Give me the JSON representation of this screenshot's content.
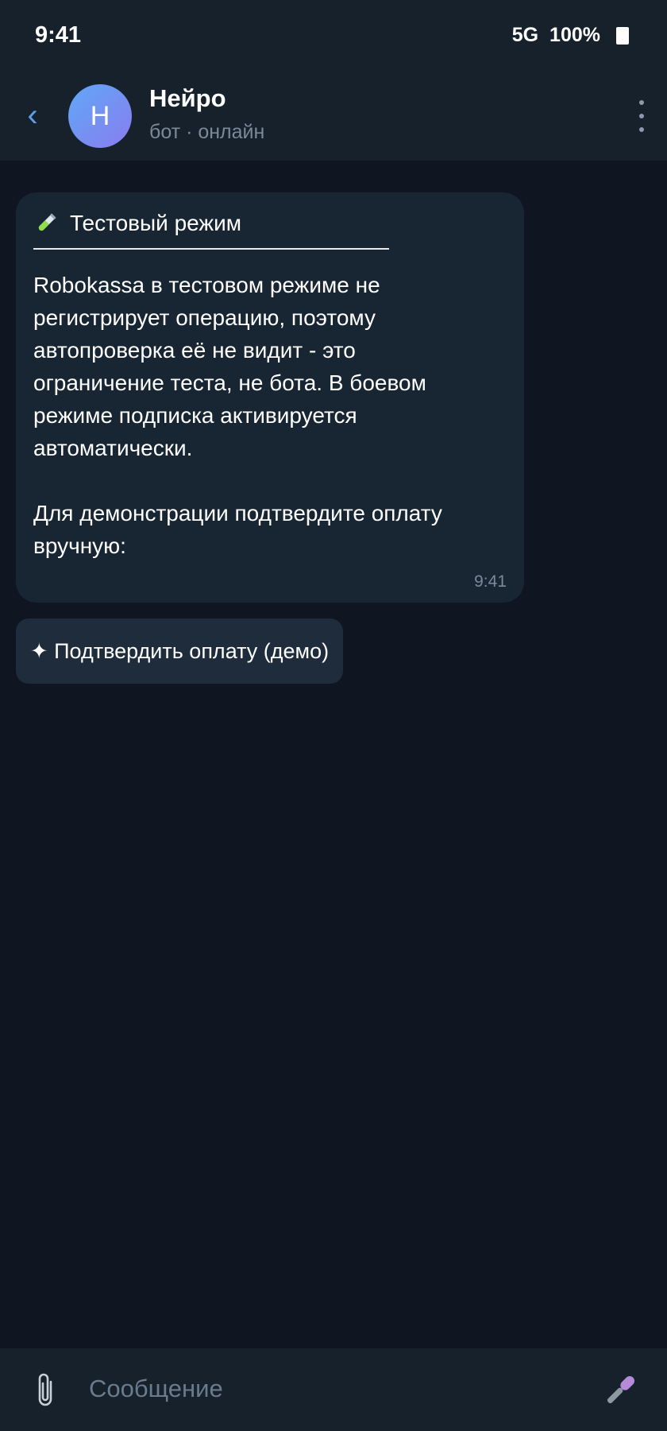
{
  "status_bar": {
    "time": "9:41",
    "network": "5G",
    "battery": "100%"
  },
  "header": {
    "back_icon": "‹",
    "avatar_letter": "Н",
    "title": "Нейро",
    "subtitle": "бот · онлайн"
  },
  "message": {
    "heading_icon": "test-tube-icon",
    "heading": "Тестовый режим",
    "body": "Robokassa в тестовом режиме не\nрегистрирует операцию, поэтому\nавтопроверка её не видит - это\nограничение теста, не бота. В боевом\nрежиме подписка активируется\nавтоматически.\n\nДля демонстрации подтвердите оплату\nвручную:",
    "time": "9:41"
  },
  "inline_button": {
    "label": "✦ Подтвердить оплату (демо)"
  },
  "composer": {
    "placeholder": "Сообщение"
  },
  "colors": {
    "background": "#0f1621",
    "bar": "#17212b",
    "bubble": "#182533",
    "inline_button": "#1e2c3c",
    "accent": "#5aa0e8",
    "muted_text": "#7b8a99"
  }
}
